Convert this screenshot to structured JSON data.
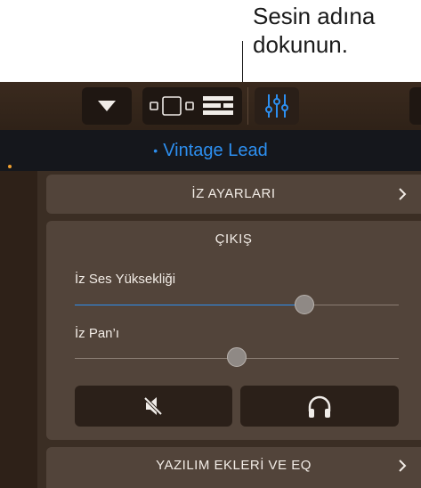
{
  "callout": {
    "text": "Sesin adına\ndokunun."
  },
  "header": {
    "track_name": "Vintage Lead",
    "dot": "•",
    "accent": "#2d8ff0"
  },
  "toolbar": {
    "items": [
      {
        "name": "dropdown-triangle-icon"
      },
      {
        "name": "view-toggle-icon"
      },
      {
        "name": "tracks-list-icon"
      },
      {
        "name": "mixer-controls-icon",
        "active": true
      }
    ]
  },
  "track_settings": {
    "label": "İZ AYARLARI"
  },
  "output": {
    "title": "ÇIKIŞ",
    "volume": {
      "label": "İz Ses Yüksekliği",
      "value_fraction": 0.71
    },
    "pan": {
      "label": "İz Pan’ı",
      "value_fraction": 0.5
    },
    "buttons": [
      {
        "name": "mute-button",
        "icon": "speaker-muted-icon"
      },
      {
        "name": "solo-button",
        "icon": "headphones-icon"
      }
    ]
  },
  "plugins_eq": {
    "label": "YAZILIM EKLERİ VE EQ"
  }
}
